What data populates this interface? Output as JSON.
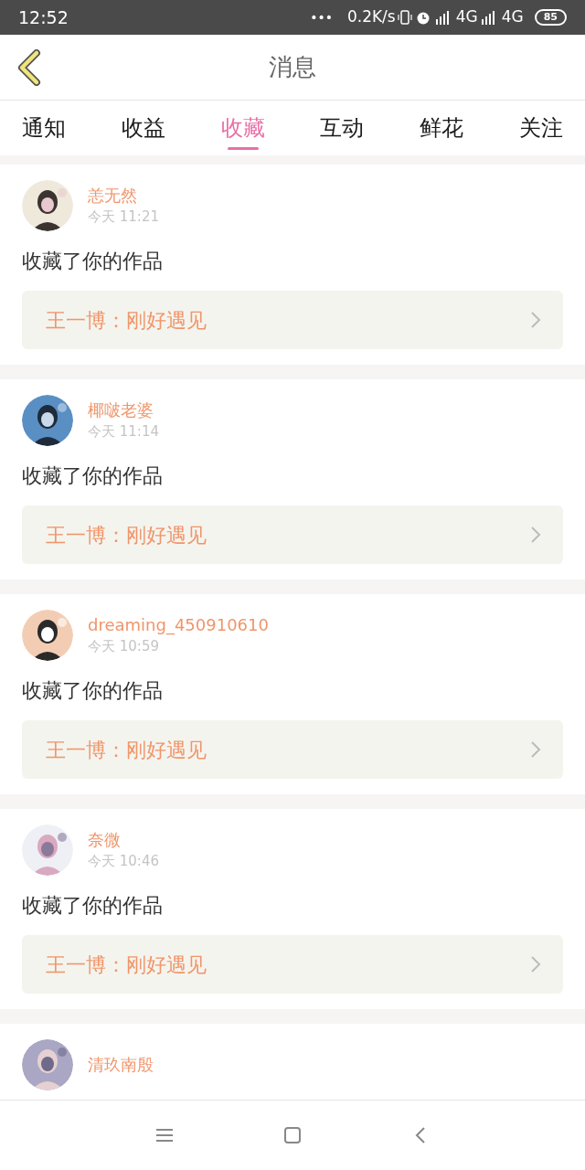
{
  "status_bar": {
    "time": "12:52",
    "dots": "•••",
    "speed": "0.2K/s",
    "network_1": "4G",
    "network_2": "4G",
    "battery": "85"
  },
  "header": {
    "title": "消息"
  },
  "tabs": [
    {
      "label": "通知",
      "selected": false
    },
    {
      "label": "收益",
      "selected": false
    },
    {
      "label": "收藏",
      "selected": true
    },
    {
      "label": "互动",
      "selected": false
    },
    {
      "label": "鲜花",
      "selected": false
    },
    {
      "label": "关注",
      "selected": false
    }
  ],
  "messages": [
    {
      "name": "恙无然",
      "time": "今天 11:21",
      "action": "收藏了你的作品",
      "work": "王一博：刚好遇见"
    },
    {
      "name": "椰啵老婆",
      "time": "今天 11:14",
      "action": "收藏了你的作品",
      "work": "王一博：刚好遇见"
    },
    {
      "name": "dreaming_450910610",
      "time": "今天 10:59",
      "action": "收藏了你的作品",
      "work": "王一博：刚好遇见"
    },
    {
      "name": "奈微",
      "time": "今天 10:46",
      "action": "收藏了你的作品",
      "work": "王一博：刚好遇见"
    },
    {
      "name": "清玖南殷"
    }
  ]
}
